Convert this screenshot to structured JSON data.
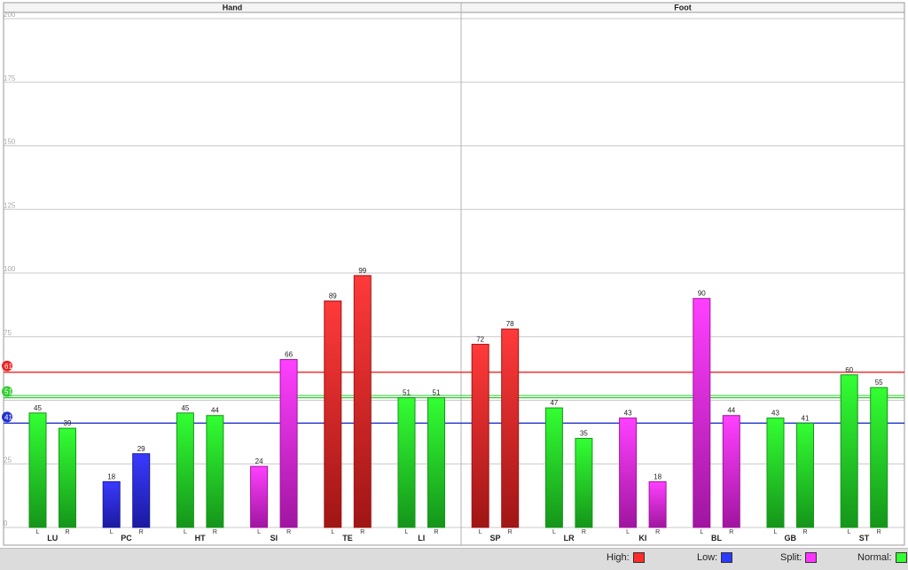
{
  "chart_data": {
    "type": "bar",
    "groups": [
      {
        "name": "Hand",
        "meridians": [
          "LU",
          "PC",
          "HT",
          "SI",
          "TE",
          "LI"
        ]
      },
      {
        "name": "Foot",
        "meridians": [
          "SP",
          "LR",
          "KI",
          "BL",
          "GB",
          "ST"
        ]
      }
    ],
    "sides": [
      "L",
      "R"
    ],
    "categories": [
      "LU",
      "PC",
      "HT",
      "SI",
      "TE",
      "LI",
      "SP",
      "LR",
      "KI",
      "BL",
      "GB",
      "ST"
    ],
    "series": [
      {
        "values": [
          45,
          18,
          45,
          24,
          89,
          51,
          72,
          47,
          43,
          90,
          43,
          60
        ]
      },
      {
        "values": [
          39,
          29,
          44,
          66,
          99,
          51,
          78,
          35,
          18,
          44,
          41,
          55
        ]
      }
    ],
    "bar_status": [
      [
        "normal",
        "low",
        "normal",
        "split",
        "high",
        "normal",
        "high",
        "normal",
        "split",
        "split",
        "normal",
        "normal"
      ],
      [
        "normal",
        "low",
        "normal",
        "split",
        "high",
        "normal",
        "high",
        "normal",
        "split",
        "split",
        "normal",
        "normal"
      ]
    ],
    "ylim": [
      0,
      200
    ],
    "yticks": [
      0,
      25,
      50,
      75,
      100,
      125,
      150,
      175,
      200
    ],
    "reference_lines": [
      {
        "key": "high",
        "value": 61,
        "label": "61",
        "color": "#ee2222"
      },
      {
        "key": "normal",
        "value": 51,
        "label": "51",
        "color": "#33cc33"
      },
      {
        "key": "low",
        "value": 41,
        "label": "41",
        "color": "#2233cc"
      }
    ],
    "legend": [
      {
        "key": "high",
        "label": "High:",
        "color": "#ff2a2a"
      },
      {
        "key": "low",
        "label": "Low:",
        "color": "#2a3aff"
      },
      {
        "key": "split",
        "label": "Split:",
        "color": "#ff33ff"
      },
      {
        "key": "normal",
        "label": "Normal:",
        "color": "#33ff33"
      }
    ],
    "legend_placement": "bottom-right",
    "grid": true,
    "status_colors": {
      "high": [
        "#ff3a3a",
        "#a01515"
      ],
      "low": [
        "#3a3aff",
        "#1a1aa0"
      ],
      "split": [
        "#ff40ff",
        "#a015a0"
      ],
      "normal": [
        "#33ff33",
        "#15951a"
      ]
    }
  }
}
